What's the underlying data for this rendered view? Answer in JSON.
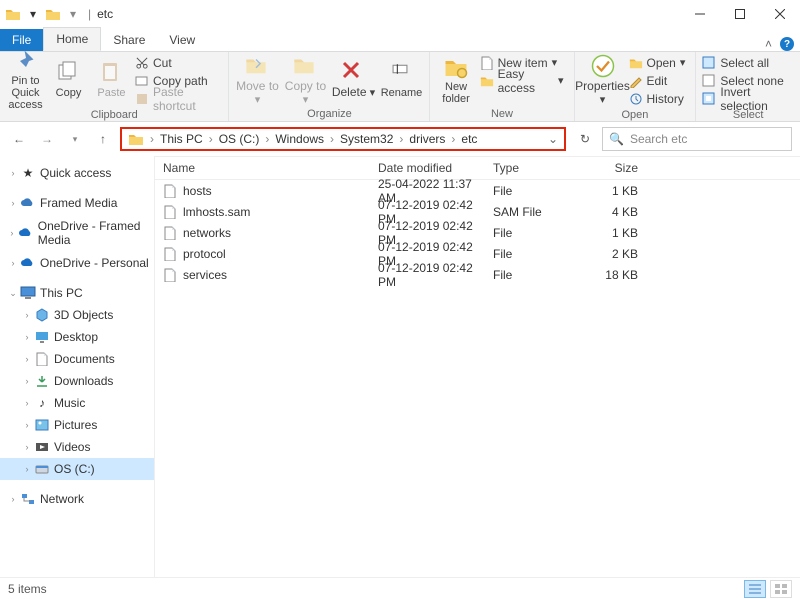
{
  "window": {
    "title": "etc"
  },
  "tabs": {
    "file": "File",
    "home": "Home",
    "share": "Share",
    "view": "View"
  },
  "ribbon": {
    "clipboard": {
      "label": "Clipboard",
      "pin": "Pin to Quick access",
      "copy": "Copy",
      "paste": "Paste",
      "cut": "Cut",
      "copy_path": "Copy path",
      "paste_shortcut": "Paste shortcut"
    },
    "organize": {
      "label": "Organize",
      "move_to": "Move to",
      "copy_to": "Copy to",
      "delete": "Delete",
      "rename": "Rename"
    },
    "new": {
      "label": "New",
      "new_folder": "New folder",
      "new_item": "New item",
      "easy_access": "Easy access"
    },
    "open": {
      "label": "Open",
      "properties": "Properties",
      "open": "Open",
      "edit": "Edit",
      "history": "History"
    },
    "select": {
      "label": "Select",
      "select_all": "Select all",
      "select_none": "Select none",
      "invert": "Invert selection"
    }
  },
  "breadcrumb": [
    "This PC",
    "OS (C:)",
    "Windows",
    "System32",
    "drivers",
    "etc"
  ],
  "search": {
    "placeholder": "Search etc"
  },
  "tree": {
    "quick_access": "Quick access",
    "framed_media": "Framed Media",
    "onedrive_framed": "OneDrive - Framed Media",
    "onedrive_personal": "OneDrive - Personal",
    "this_pc": "This PC",
    "objects3d": "3D Objects",
    "desktop": "Desktop",
    "documents": "Documents",
    "downloads": "Downloads",
    "music": "Music",
    "pictures": "Pictures",
    "videos": "Videos",
    "os_c": "OS (C:)",
    "network": "Network"
  },
  "columns": {
    "name": "Name",
    "date": "Date modified",
    "type": "Type",
    "size": "Size"
  },
  "files": [
    {
      "name": "hosts",
      "date": "25-04-2022 11:37 AM",
      "type": "File",
      "size": "1 KB"
    },
    {
      "name": "lmhosts.sam",
      "date": "07-12-2019 02:42 PM",
      "type": "SAM File",
      "size": "4 KB"
    },
    {
      "name": "networks",
      "date": "07-12-2019 02:42 PM",
      "type": "File",
      "size": "1 KB"
    },
    {
      "name": "protocol",
      "date": "07-12-2019 02:42 PM",
      "type": "File",
      "size": "2 KB"
    },
    {
      "name": "services",
      "date": "07-12-2019 02:42 PM",
      "type": "File",
      "size": "18 KB"
    }
  ],
  "status": {
    "items": "5 items"
  }
}
